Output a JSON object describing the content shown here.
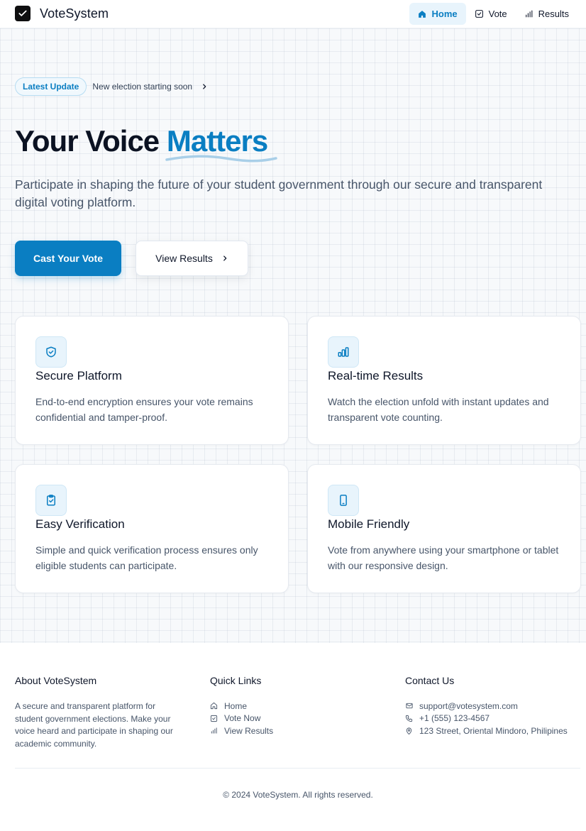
{
  "brand": {
    "name": "VoteSystem",
    "logo_icon": "check-icon"
  },
  "nav": {
    "items": [
      {
        "label": "Home",
        "icon": "home-icon",
        "active": true
      },
      {
        "label": "Vote",
        "icon": "check-square-icon",
        "active": false
      },
      {
        "label": "Results",
        "icon": "bar-chart-icon",
        "active": false
      }
    ]
  },
  "hero": {
    "badge": "Latest Update",
    "update_text": "New election starting soon",
    "title_main": "Your Voice",
    "title_accent": "Matters",
    "subtitle": "Participate in shaping the future of your student government through our secure and transparent digital voting platform.",
    "primary_button": "Cast Your Vote",
    "secondary_button": "View Results"
  },
  "features": [
    {
      "icon": "shield-check-icon",
      "title": "Secure Platform",
      "description": "End-to-end encryption ensures your vote remains confidential and tamper-proof."
    },
    {
      "icon": "bar-chart-icon",
      "title": "Real-time Results",
      "description": "Watch the election unfold with instant updates and transparent vote counting."
    },
    {
      "icon": "clipboard-check-icon",
      "title": "Easy Verification",
      "description": "Simple and quick verification process ensures only eligible students can participate."
    },
    {
      "icon": "smartphone-icon",
      "title": "Mobile Friendly",
      "description": "Vote from anywhere using your smartphone or tablet with our responsive design."
    }
  ],
  "footer": {
    "about": {
      "title": "About VoteSystem",
      "text": "A secure and transparent platform for student government elections. Make your voice heard and participate in shaping our academic community."
    },
    "quick_links": {
      "title": "Quick Links",
      "items": [
        {
          "label": "Home",
          "icon": "home-icon"
        },
        {
          "label": "Vote Now",
          "icon": "check-square-icon"
        },
        {
          "label": "View Results",
          "icon": "bar-chart-icon"
        }
      ]
    },
    "contact": {
      "title": "Contact Us",
      "items": [
        {
          "label": "support@votesystem.com",
          "icon": "mail-icon"
        },
        {
          "label": "+1 (555) 123-4567",
          "icon": "phone-icon"
        },
        {
          "label": "123 Street, Oriental Mindoro, Philipines",
          "icon": "map-pin-icon"
        }
      ]
    },
    "copyright": "© 2024 VoteSystem. All rights reserved."
  },
  "colors": {
    "accent": "#0a7ec2",
    "accent_light": "#e8f4fc",
    "text": "#0f172a",
    "muted": "#475569"
  }
}
